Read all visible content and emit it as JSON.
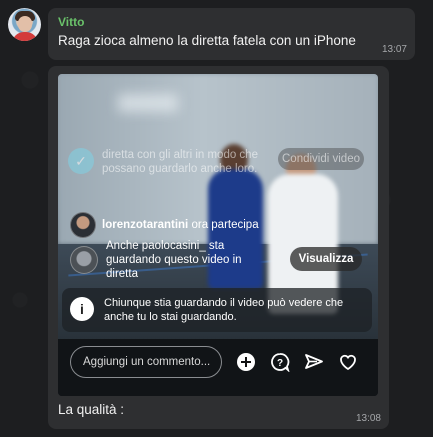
{
  "message1": {
    "sender": "Vitto",
    "text": "Raga zioca almeno la diretta fatela con un iPhone",
    "time": "13:07"
  },
  "message2": {
    "caption": "La qualità :",
    "time": "13:08",
    "media": {
      "faded_notice": "diretta con gli altri in modo che possano guardarlo anche loro.",
      "faded_button": "Condividi video",
      "join_user": "lorenzotarantini",
      "join_text": "ora partecipa",
      "watch_text": "Anche paolocasini_ sta guardando questo video in diretta",
      "watch_button": "Visualizza",
      "info_text": "Chiunque stia guardando il video può vedere che anche tu lo stai guardando.",
      "comment_placeholder": "Aggiungi un commento...",
      "icons": [
        "add-icon",
        "question-icon",
        "send-icon",
        "heart-icon"
      ]
    }
  },
  "colors": {
    "sender_name": "#6ac26a",
    "bubble": "#2e2f31",
    "background": "#1d1e20"
  }
}
